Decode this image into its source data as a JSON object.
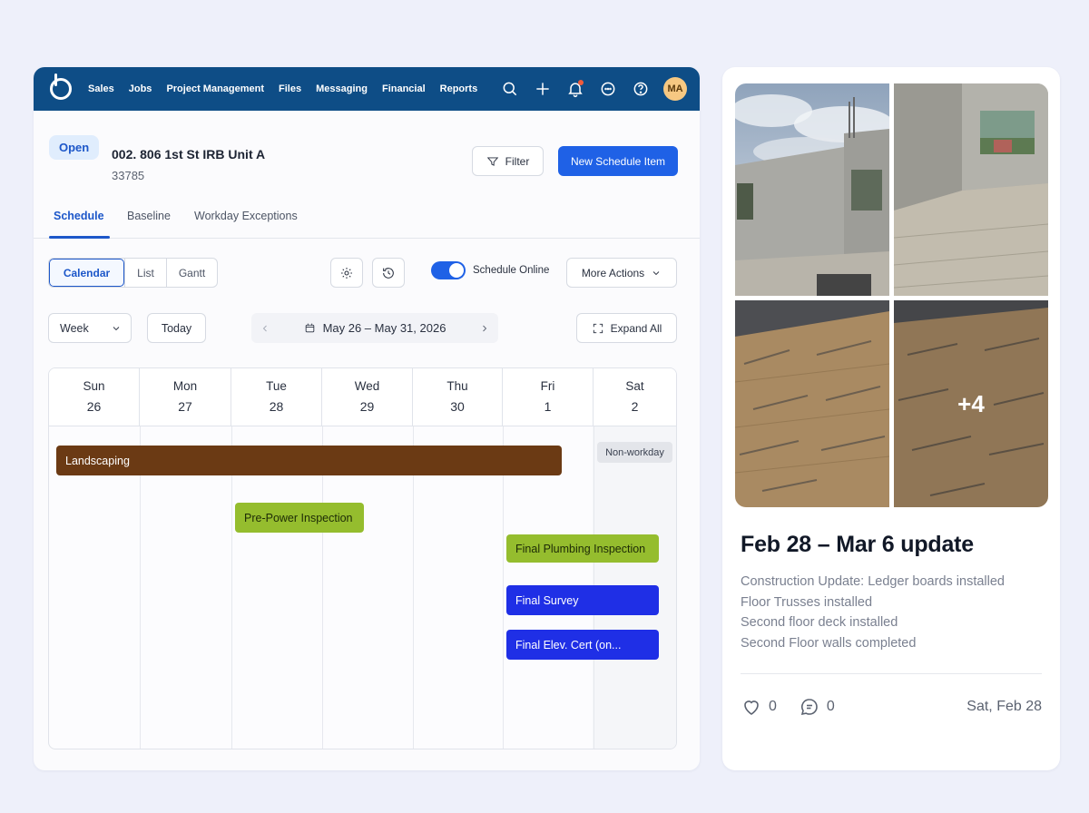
{
  "nav": {
    "items": [
      "Sales",
      "Jobs",
      "Project Management",
      "Files",
      "Messaging",
      "Financial",
      "Reports"
    ],
    "avatar_initials": "MA",
    "icons": [
      "search-icon",
      "plus-icon",
      "bell-icon",
      "chat-icon",
      "help-icon"
    ]
  },
  "job": {
    "status": "Open",
    "title": "002. 806 1st St IRB Unit A",
    "number": "33785"
  },
  "actions": {
    "filter_label": "Filter",
    "new_item_label": "New Schedule Item",
    "more_actions_label": "More Actions",
    "expand_all_label": "Expand All",
    "today_label": "Today",
    "schedule_online_label": "Schedule Online",
    "schedule_online_on": true
  },
  "tabs": [
    "Schedule",
    "Baseline",
    "Workday Exceptions"
  ],
  "views": [
    "Calendar",
    "List",
    "Gantt"
  ],
  "range_select": "Week",
  "date_range": "May 26 – May 31, 2026",
  "calendar": {
    "days": [
      {
        "name": "Sun",
        "num": "26"
      },
      {
        "name": "Mon",
        "num": "27"
      },
      {
        "name": "Tue",
        "num": "28"
      },
      {
        "name": "Wed",
        "num": "29"
      },
      {
        "name": "Thu",
        "num": "30"
      },
      {
        "name": "Fri",
        "num": "1"
      },
      {
        "name": "Sat",
        "num": "2"
      }
    ],
    "nonworkday_label": "Non-workday",
    "events": [
      {
        "label": "Landscaping",
        "color": "#6b3a14",
        "text_color": "#ffffff"
      },
      {
        "label": "Pre-Power Inspection",
        "color": "#95bd2e",
        "text_color": "#1d2b06"
      },
      {
        "label": "Final Plumbing Inspection",
        "color": "#95bd2e",
        "text_color": "#1d2b06"
      },
      {
        "label": "Final Survey",
        "color": "#1f2fe6",
        "text_color": "#ffffff"
      },
      {
        "label": "Final Elev. Cert (on...",
        "color": "#1f2fe6",
        "text_color": "#ffffff"
      }
    ]
  },
  "update_card": {
    "more_photos": "+4",
    "title": "Feb 28 – Mar 6 update",
    "lines": [
      "Construction Update: Ledger boards installed",
      "Floor Trusses installed",
      "Second floor deck installed",
      "Second Floor walls completed"
    ],
    "likes": "0",
    "comments": "0",
    "date": "Sat, Feb 28"
  },
  "colors": {
    "nav_bg": "#0e4d86",
    "primary": "#1f61e6",
    "page_bg": "#eef0fa"
  }
}
